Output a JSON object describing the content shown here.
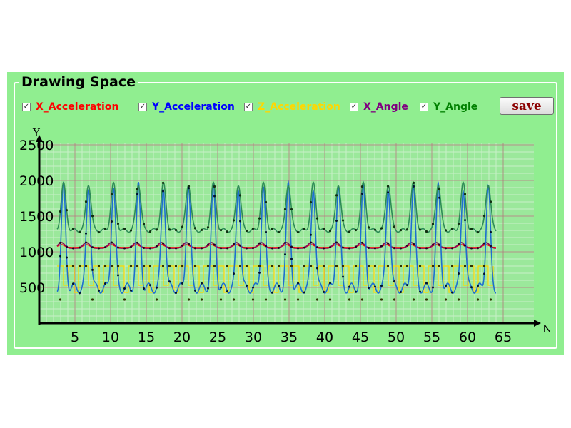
{
  "panel": {
    "title": "Drawing Space",
    "save_label": "save"
  },
  "legend": [
    {
      "label": "X_Acceleration",
      "color": "#ff0000",
      "checked": true
    },
    {
      "label": "Y_Acceleration",
      "color": "#0000ff",
      "checked": true
    },
    {
      "label": "Z_Acceleration",
      "color": "#ffd700",
      "checked": true
    },
    {
      "label": "X_Angle",
      "color": "#800080",
      "checked": true
    },
    {
      "label": "Y_Angle",
      "color": "#008000",
      "checked": true
    }
  ],
  "colors": {
    "panel_bg": "#90ee90",
    "plot_bg": "#9be89b",
    "grid_major": "#b07a7a",
    "grid_minor": "#c8f0c8",
    "line_green": "#2e8b57",
    "line_blue": "#1e6fd0",
    "line_purple": "#8b0a5a"
  },
  "chart_data": {
    "type": "line",
    "xlabel": "N",
    "ylabel": "Y",
    "xlim": [
      0,
      70
    ],
    "ylim": [
      0,
      2500
    ],
    "x_ticks": [
      5,
      10,
      15,
      20,
      25,
      30,
      35,
      40,
      45,
      50,
      55,
      60,
      65
    ],
    "y_ticks": [
      500,
      1000,
      1500,
      2000,
      2500
    ],
    "grid": true,
    "period": 3.5,
    "cycles": 18,
    "series": [
      {
        "name": "Y_Angle",
        "color": "#008000",
        "base": 1300,
        "peak": 1950,
        "desc": "periodic peaks ~1950, baseline ~1300"
      },
      {
        "name": "X_Angle",
        "color": "#800080",
        "base": 1050,
        "peak": 1130,
        "desc": "near 1050 with small bumps to ~1130"
      },
      {
        "name": "X_Acceleration",
        "color": "#ff0000",
        "base": 1060,
        "peak": 1100
      },
      {
        "name": "Y_Acceleration",
        "color": "#0000ff",
        "base": 530,
        "min": 420,
        "peak": 1950,
        "desc": "oscillates ~430–560 with large spikes"
      },
      {
        "name": "Z_Acceleration",
        "color": "#ffd700",
        "high": 800,
        "low": 330,
        "desc": "square-like 800 / 330"
      }
    ]
  }
}
